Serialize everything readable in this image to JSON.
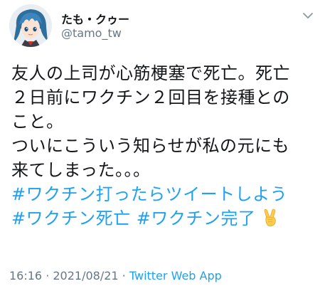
{
  "tweet": {
    "display_name": "たも・クゥー",
    "handle": "@tamo_tw",
    "lines": [
      "友人の上司が心筋梗塞で死亡。死亡",
      "２日前にワクチン２回目を接種との",
      "こと。",
      "ついにこういう知らせが私の元にも",
      "来てしまった。。。"
    ],
    "hashtags": {
      "tag1": "#ワクチン打ったらツイートしよう",
      "tag2": "#ワクチン死亡",
      "tag3": "#ワクチン完了"
    },
    "emoji_name": "victory-hand-emoji",
    "time": "16:16",
    "separator1": " · ",
    "date": "2021/08/21",
    "separator2": " · ",
    "source": "Twitter Web App"
  },
  "colors": {
    "link": "#1da1f2",
    "secondary_text": "#657786",
    "primary_text": "#14171a"
  },
  "icons": {
    "more": "chevron-down-icon",
    "avatar": "avatar"
  }
}
